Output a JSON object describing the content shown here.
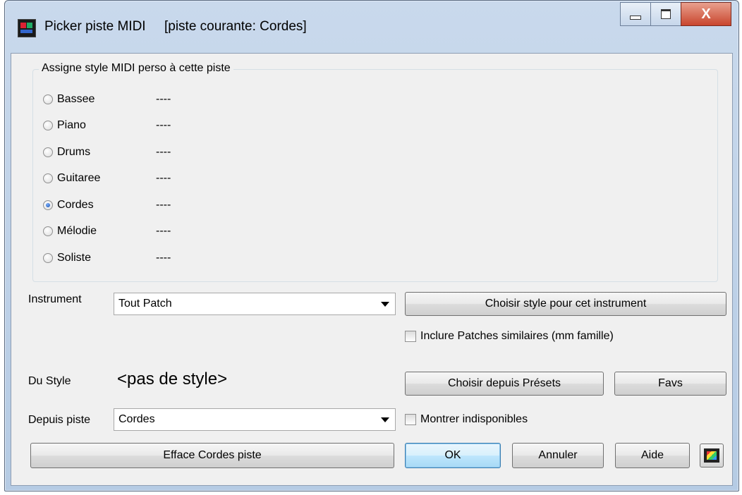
{
  "window": {
    "title": "Picker piste MIDI     [piste courante: Cordes]",
    "close_glyph": "X"
  },
  "group": {
    "legend": "Assigne style MIDI perso à cette piste",
    "tracks": [
      {
        "label": "Bassee",
        "value": "----",
        "checked": false
      },
      {
        "label": "Piano",
        "value": "----",
        "checked": false
      },
      {
        "label": "Drums",
        "value": "----",
        "checked": false
      },
      {
        "label": "Guitaree",
        "value": "----",
        "checked": false
      },
      {
        "label": "Cordes",
        "value": "----",
        "checked": true
      },
      {
        "label": "Mélodie",
        "value": "----",
        "checked": false
      },
      {
        "label": "Soliste",
        "value": "----",
        "checked": false
      }
    ]
  },
  "instrument": {
    "label": "Instrument",
    "selected": "Tout Patch",
    "choose_button": "Choisir style pour cet instrument",
    "similar_patches_label": "Inclure Patches similaires (mm famille)"
  },
  "style": {
    "label": "Du Style",
    "name": "<pas de style>",
    "presets_button": "Choisir depuis Présets",
    "favs_button": "Favs"
  },
  "source": {
    "label": "Depuis piste",
    "selected": "Cordes",
    "show_unavailable_label": "Montrer indisponibles"
  },
  "footer": {
    "clear_button": "Efface Cordes piste",
    "ok_button": "OK",
    "cancel_button": "Annuler",
    "help_button": "Aide"
  },
  "colors": {
    "dialog_bg": "#f0f0f0",
    "frame": "#b5cbe4",
    "close_button": "#c9452d"
  }
}
